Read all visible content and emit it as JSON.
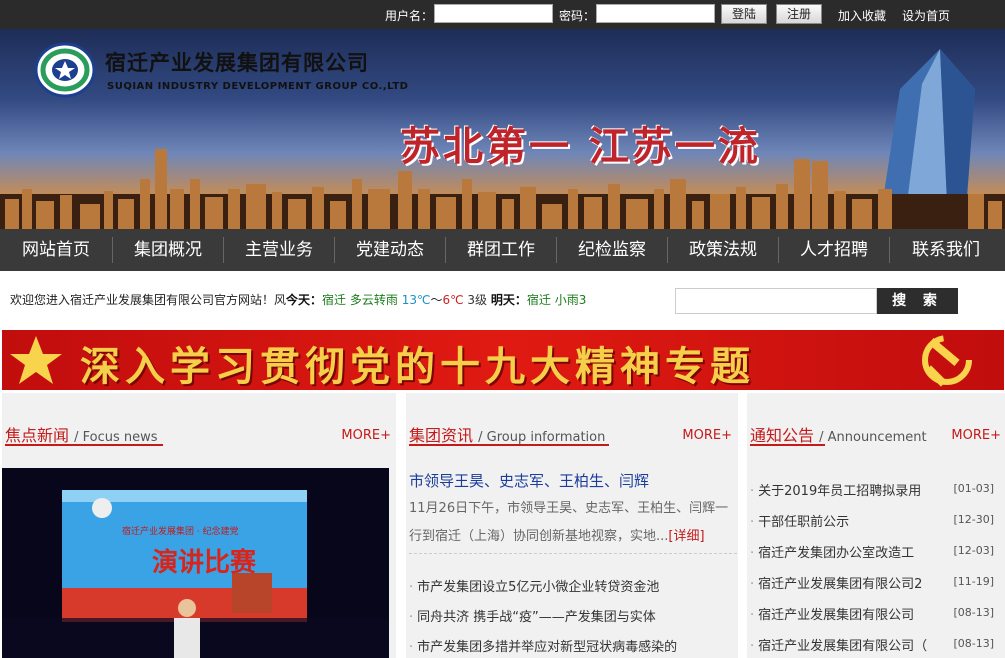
{
  "topbar": {
    "username_label": "用户名：",
    "username_value": "",
    "password_label": "密码：",
    "password_value": "",
    "login_label": "登陆",
    "register_label": "注册",
    "favorite_label": "加入收藏",
    "homepage_label": "设为首页"
  },
  "banner": {
    "company_cn": "宿迁产业发展集团有限公司",
    "company_en": "SUQIAN INDUSTRY DEVELOPMENT GROUP CO.,LTD",
    "slogan": "苏北第一 江苏一流"
  },
  "nav": {
    "items": [
      "网站首页",
      "集团概况",
      "主营业务",
      "党建动态",
      "群团工作",
      "纪检监察",
      "政策法规",
      "人才招聘",
      "联系我们"
    ]
  },
  "welcome": {
    "text": "欢迎您进入宿迁产业发展集团有限公司官方网站！",
    "wind_prefix": "风",
    "today_label": "今天：",
    "today_weather": "宿迁 多云转雨",
    "today_high": "13℃",
    "today_sep": "～",
    "today_low": "6℃",
    "today_wind": "3级",
    "tomorrow_label": "明天：",
    "tomorrow_weather": "宿迁",
    "tomorrow_weather2": "小雨3"
  },
  "search": {
    "placeholder": "",
    "button_label": "搜 索"
  },
  "red_banner": {
    "title": "深入学习贯彻党的十九大精神专题"
  },
  "focus": {
    "title": "焦点新闻",
    "title_en": "/ Focus news",
    "more": "MORE+",
    "image_texts": {
      "sub": "宿迁产业发展集团 · 纪念建党",
      "main": "演讲比赛"
    }
  },
  "group_info": {
    "title": "集团资讯",
    "title_en": "/ Group information",
    "more": "MORE+",
    "headline": "市领导王昊、史志军、王柏生、闫辉",
    "desc": "11月26日下午，市领导王昊、史志军、王柏生、闫辉一行到宿迁（上海）协同创新基地视察，实地...",
    "detail_label": "[详细]",
    "items": [
      "市产发集团设立5亿元小微企业转贷资金池",
      "同舟共济 携手战“疫”——产发集团与实体",
      "市产发集团多措并举应对新型冠状病毒感染的"
    ]
  },
  "notice": {
    "title": "通知公告",
    "title_en": "/ Announcement",
    "more": "MORE+",
    "items": [
      {
        "title": "关于2019年员工招聘拟录用",
        "date": "[01-03]"
      },
      {
        "title": "干部任职前公示",
        "date": "[12-30]"
      },
      {
        "title": "宿迁产发集团办公室改造工",
        "date": "[12-03]"
      },
      {
        "title": "宿迁产业发展集团有限公司2",
        "date": "[11-19]"
      },
      {
        "title": "宿迁产业发展集团有限公司",
        "date": "[08-13]"
      },
      {
        "title": "宿迁产业发展集团有限公司（",
        "date": "[08-13]"
      }
    ]
  },
  "colors": {
    "accent_red": "#c41a1a",
    "nav_bg": "#3a3a3a",
    "topbar_bg": "#2b2b2b",
    "link_blue": "#1a3c9c"
  }
}
